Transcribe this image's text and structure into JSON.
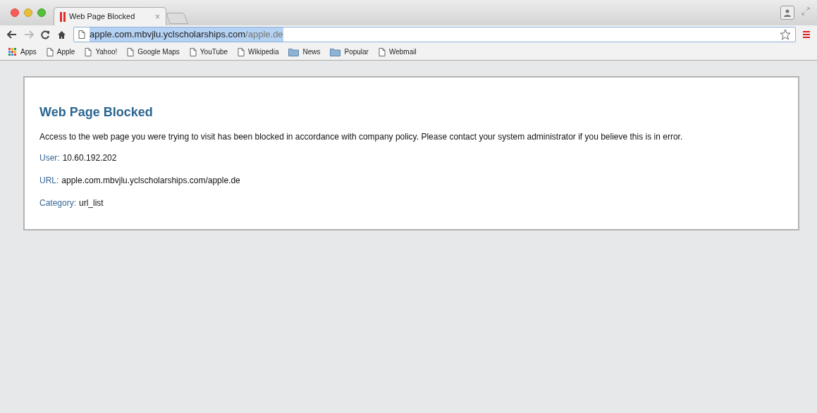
{
  "tab": {
    "title": "Web Page Blocked",
    "close": "×",
    "selected": true
  },
  "address": {
    "host": "apple.com.mbvjlu.yclscholarships.com",
    "path": "/apple.de",
    "selected": true
  },
  "bookmarks": [
    {
      "kind": "apps",
      "label": "Apps"
    },
    {
      "kind": "page",
      "label": "Apple"
    },
    {
      "kind": "page",
      "label": "Yahoo!"
    },
    {
      "kind": "page",
      "label": "Google Maps"
    },
    {
      "kind": "page",
      "label": "YouTube"
    },
    {
      "kind": "page",
      "label": "Wikipedia"
    },
    {
      "kind": "folder",
      "label": "News"
    },
    {
      "kind": "folder",
      "label": "Popular"
    },
    {
      "kind": "page",
      "label": "Webmail"
    }
  ],
  "page": {
    "heading": "Web Page Blocked",
    "message": "Access to the web page you were trying to visit has been blocked in accordance with company policy. Please contact your system administrator if you believe this is in error.",
    "fields": [
      {
        "label": "User:",
        "value": "10.60.192.202"
      },
      {
        "label": "URL:",
        "value": "apple.com.mbvjlu.yclscholarships.com/apple.de"
      },
      {
        "label": "Category:",
        "value": "url_list"
      }
    ]
  }
}
